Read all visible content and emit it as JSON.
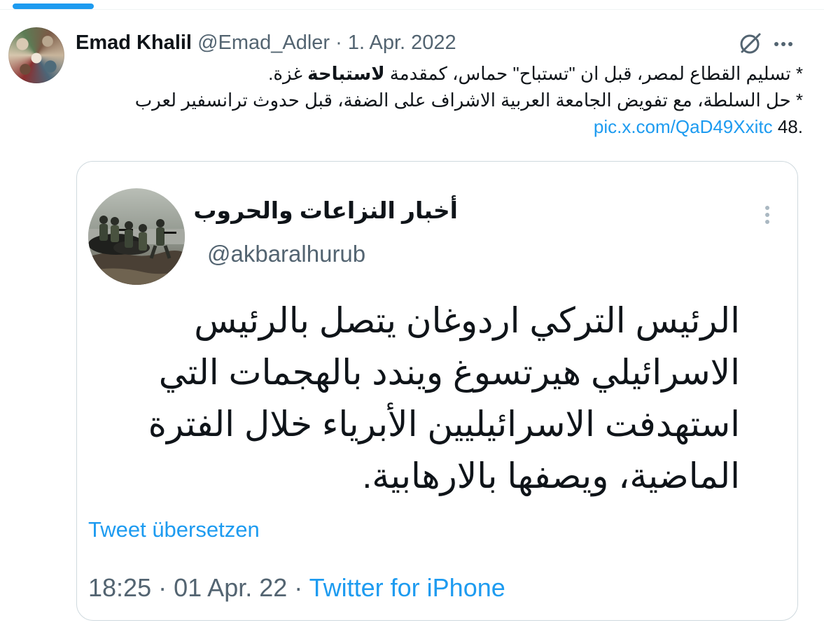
{
  "tweet": {
    "author_name": "Emad Khalil",
    "handle": "@Emad_Adler",
    "separator": "·",
    "date": "1. Apr. 2022",
    "icons": [
      "grok-icon",
      "more-options-icon"
    ],
    "lines": {
      "line1_start": "* تسليم القطاع لمصر، قبل ان \"تستباح\" حماس، كمقدمة ",
      "line1_bold": "لاستباحة",
      "line1_end": " غزة.",
      "line2": "* حل السلطة، مع تفويض الجامعة العربية الاشراف على الضفة، قبل حدوث ترانسفير لعرب",
      "line3_text": "48.",
      "line3_link": "pic.x.com/QaD49Xxitc"
    }
  },
  "quoted_tweet": {
    "author_name": "أخبار النزاعات والحروب",
    "handle": "@akbaralhurub",
    "text_lines": [
      "الرئيس التركي اردوغان يتصل بالرئيس",
      "الاسرائيلي هيرتسوغ ويندد بالهجمات التي",
      "استهدفت الاسرائيليين الأبرياء خلال الفترة",
      "الماضية، ويصفها بالارهابية."
    ],
    "translate_label": "Tweet übersetzen",
    "time": "18:25",
    "meta_separator": "·",
    "date": "01 Apr. 22",
    "source": "Twitter for iPhone"
  },
  "colors": {
    "accent": "#1d9bf0",
    "text": "#0f1419",
    "muted": "#536471",
    "border": "#cfd9de"
  }
}
